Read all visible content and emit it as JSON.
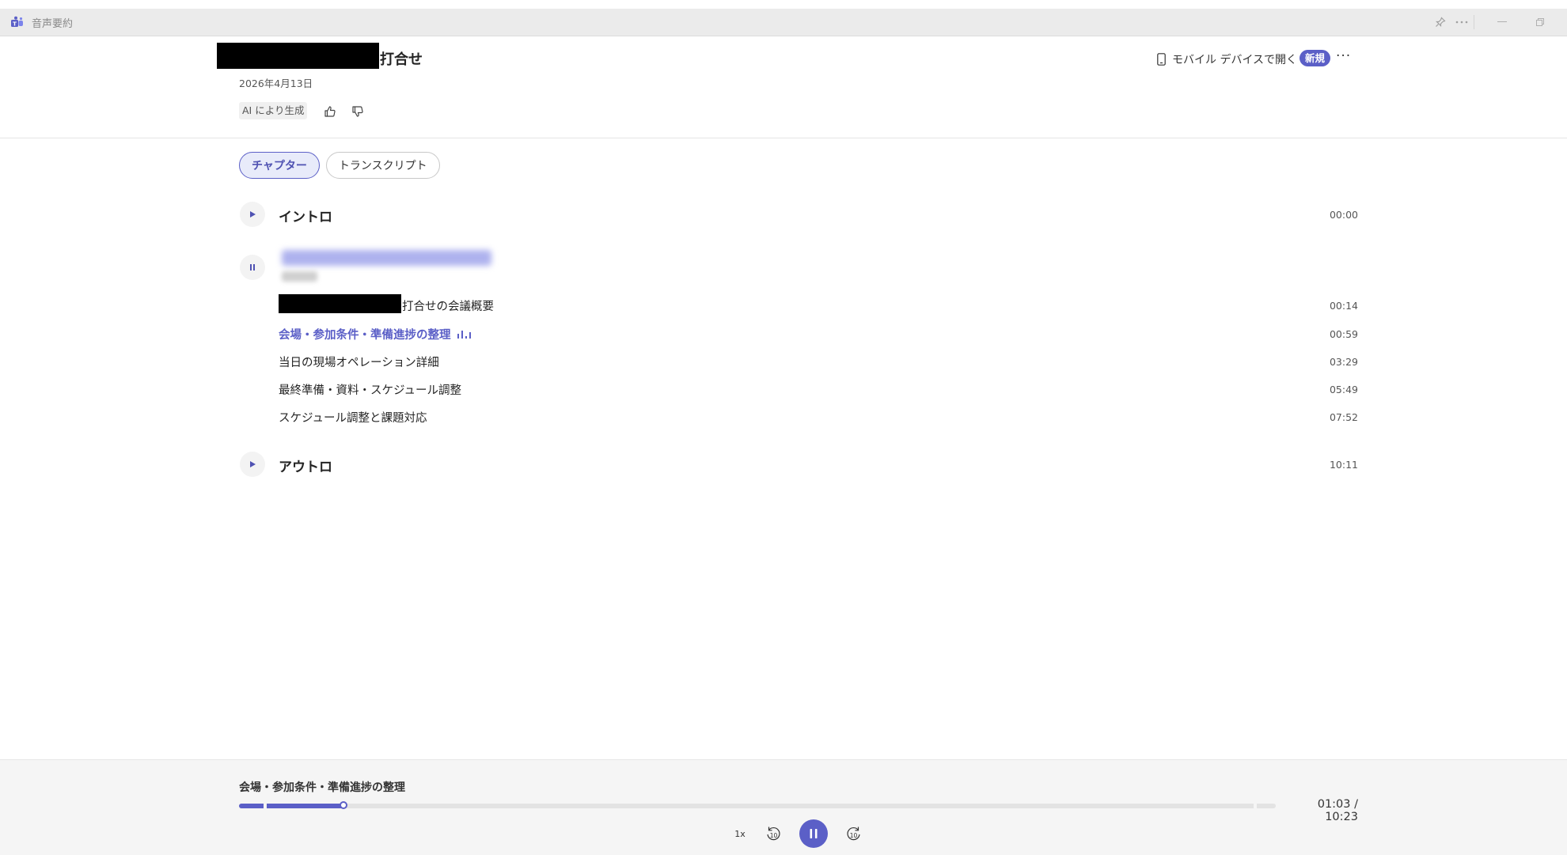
{
  "app": {
    "title": "音声要約"
  },
  "header": {
    "title_suffix": "打合せ",
    "date": "2026年4月13日",
    "ai_label": "AI により生成",
    "mobile_label": "モバイル デバイスで開く",
    "new_badge": "新規",
    "more": "···"
  },
  "tabs": [
    {
      "label": "チャプター",
      "active": true
    },
    {
      "label": "トランスクリプト",
      "active": false
    }
  ],
  "chapters": {
    "intro": {
      "title": "イントロ",
      "time": "00:00"
    },
    "main": {
      "subchapters": [
        {
          "title": "打合せの会議概要",
          "time": "00:14"
        },
        {
          "title": "会場・参加条件・準備進捗の整理",
          "time": "00:59",
          "active": true
        },
        {
          "title": "当日の現場オペレーション詳細",
          "time": "03:29"
        },
        {
          "title": "最終準備・資料・スケジュール調整",
          "time": "05:49"
        },
        {
          "title": "スケジュール調整と課題対応",
          "time": "07:52"
        }
      ]
    },
    "outro": {
      "title": "アウトロ",
      "time": "10:11"
    }
  },
  "player": {
    "now_playing": "会場・参加条件・準備進捗の整理",
    "time_display": "01:03 / 10:23",
    "progress_fraction": 0.101,
    "speed": "1x",
    "skip_back_label": "10",
    "skip_forward_label": "10"
  },
  "colors": {
    "accent": "#5b5fc7",
    "accent_light": "#e8ebfa"
  }
}
